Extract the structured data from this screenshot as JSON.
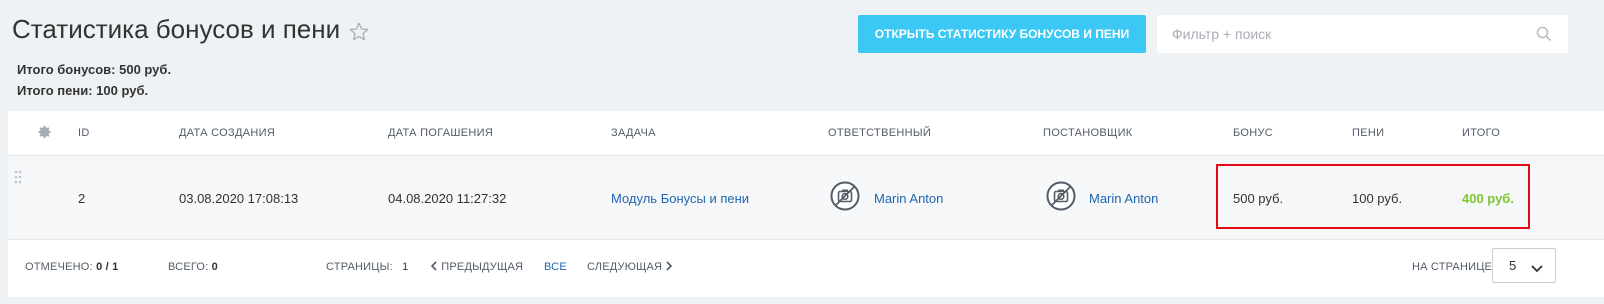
{
  "page": {
    "title": "Статистика бонусов и пени",
    "open_button": "ОТКРЫТЬ СТАТИСТИКУ БОНУСОВ И ПЕНИ",
    "search_placeholder": "Фильтр + поиск"
  },
  "summary": {
    "bonus_total": "Итого бонусов: 500 руб.",
    "penalty_total": "Итого пени: 100 руб."
  },
  "grid": {
    "columns": [
      "ID",
      "ДАТА СОЗДАНИЯ",
      "ДАТА ПОГАШЕНИЯ",
      "ЗАДАЧА",
      "ОТВЕТСТВЕННЫЙ",
      "ПОСТАНОВЩИК",
      "БОНУС",
      "ПЕНИ",
      "ИТОГО"
    ],
    "rows": [
      {
        "id": "2",
        "created": "03.08.2020 17:08:13",
        "due": "04.08.2020 11:27:32",
        "task": "Модуль Бонусы и пени",
        "responsible": "Marin Anton",
        "creator": "Marin Anton",
        "bonus": "500 руб.",
        "penalty": "100 руб.",
        "total": "400 руб."
      }
    ]
  },
  "footer": {
    "marked_label": "ОТМЕЧЕНО:",
    "marked_value": "0 / 1",
    "total_label": "ВСЕГО:",
    "total_value": "0",
    "pages_label": "СТРАНИЦЫ:",
    "current_page": "1",
    "prev": "ПРЕДЫДУЩАЯ",
    "all": "ВСЕ",
    "next": "СЛЕДУЮЩАЯ",
    "per_page_label": "НА СТРАНИЦЕ:",
    "per_page_value": "5"
  },
  "colors": {
    "accent_button": "#3bc8f5",
    "link": "#2067b0",
    "total_green": "#7fc62d",
    "highlight_red": "#e30613"
  },
  "icons": [
    "star-icon",
    "search-icon",
    "gear-icon",
    "drag-handle-icon",
    "avatar-camera-icon",
    "chevron-left-icon",
    "chevron-right-icon",
    "chevron-down-icon"
  ]
}
